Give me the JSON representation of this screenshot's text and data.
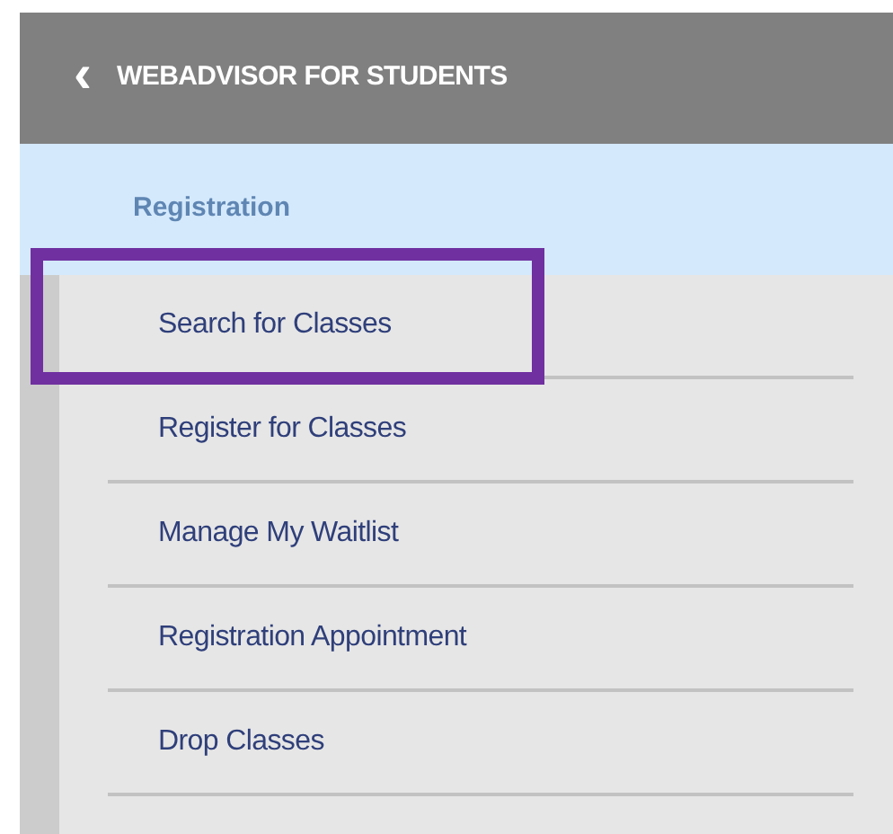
{
  "header": {
    "back_icon": "‹",
    "title": "WEBADVISOR FOR STUDENTS"
  },
  "section": {
    "title": "Registration"
  },
  "menu_items": [
    {
      "label": "Search for Classes",
      "highlighted": true
    },
    {
      "label": "Register for Classes",
      "highlighted": false
    },
    {
      "label": "Manage My Waitlist",
      "highlighted": false
    },
    {
      "label": "Registration Appointment",
      "highlighted": false
    },
    {
      "label": "Drop Classes",
      "highlighted": false
    }
  ]
}
